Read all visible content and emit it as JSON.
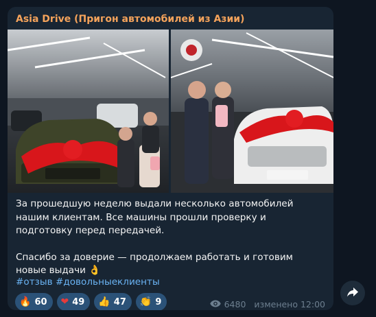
{
  "post": {
    "author": "Asia Drive (Пригон автомобилей из Азии)",
    "text_line1": "За прошедшую неделю выдали несколько автомобилей",
    "text_line2": "нашим клиентам. Все машины прошли проверку и",
    "text_line3": "подготовку перед передачей.",
    "text_line4": "Спасибо за доверие — продолжаем работать и готовим",
    "text_line5": "новые выдачи",
    "text_emoji": "👌",
    "hashtag1": "#отзыв",
    "hashtag2": "#довольныеклиенты"
  },
  "photos": [
    {
      "icon": "photo-car-delivery-dark-suv"
    },
    {
      "icon": "photo-car-delivery-white-suv"
    }
  ],
  "reactions": [
    {
      "emoji": "🔥",
      "icon": "fire-icon",
      "count": "60"
    },
    {
      "emoji": "❤",
      "icon": "heart-icon",
      "count": "49"
    },
    {
      "emoji": "👍",
      "icon": "thumbs-up-icon",
      "count": "47"
    },
    {
      "emoji": "👏",
      "icon": "clap-icon",
      "count": "9"
    }
  ],
  "meta": {
    "views": "6480",
    "edited_time": "изменено 12:00"
  },
  "colors": {
    "background": "#0e1621",
    "bubble": "#182533",
    "author": "#f5a35b",
    "link": "#6ab3f3",
    "reaction_bg": "#2b5278",
    "meta": "#6d7f8f"
  }
}
